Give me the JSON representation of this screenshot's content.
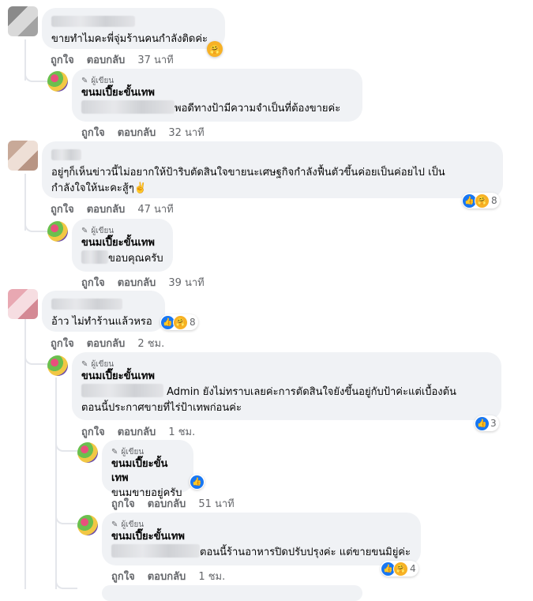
{
  "actions": {
    "like": "ถูกใจ",
    "reply": "ตอบกลับ"
  },
  "author_tag": "ผู้เขียน",
  "page_name": "ขนมเปี๊ยะขั้นเทพ",
  "admin_reply_name": "Admin",
  "comments": [
    {
      "text": "ขายทำไมคะพี่จุ่มร้านคนกำลังติดค่ะ",
      "time": "37 นาที"
    },
    {
      "reply_text": "พอดีทางป้ามีความจำเป็นที่ต้องขายค่ะ",
      "time": "32 นาที"
    },
    {
      "text_line1": "อยู่ๆก็เห็นข่าวนี้ไม่อยากให้ป้าริบตัดสินใจขายนะเศษฐกิจกำลังฟื้นตัวขึ้นค่อยเป็นค่อยไป เป็น",
      "text_line2": "กำลังใจให้นะคะสู้ๆ✌️",
      "time": "47 นาที",
      "reaction_count": "8"
    },
    {
      "reply_text": "ขอบคุณครับ",
      "time": "39 นาที"
    },
    {
      "text": "อ้าว ไม่ทำร้านแล้วหรอ",
      "time": "2 ชม.",
      "reaction_count": "8"
    },
    {
      "reply_text_line1": "ยังไม่ทราบเลยค่ะการตัดสินใจยังขึ้นอยู่กับป้าค่ะแต่เบื้องต้น",
      "reply_text_line2": "ตอนนี้ประกาศขายที่ไร่ป้าเทพก่อนค่ะ",
      "time": "1 ชม.",
      "reaction_count": "3"
    },
    {
      "reply_text": "ขนมขายอยู่ครับ",
      "time": "51 นาที"
    },
    {
      "reply_text": "ตอนนี้ร้านอาหารปิดปรับปรุงค่ะ แต่ขายขนมิยู่ค่ะ",
      "time": "1 ชม.",
      "reaction_count": "4"
    }
  ],
  "colors": {
    "like_blue": "#1877f2",
    "care_yellow": "#f7b125",
    "bubble_bg": "#f0f2f5",
    "meta_grey": "#65676b"
  }
}
